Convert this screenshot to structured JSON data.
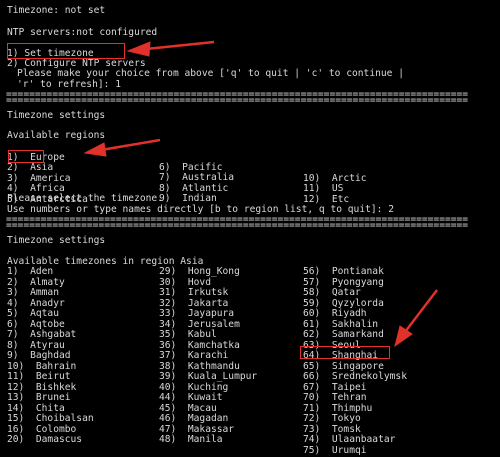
{
  "status": {
    "timezone": "Timezone: not set",
    "ntp": "NTP servers:not configured"
  },
  "main_menu": {
    "items": [
      {
        "num": "1)",
        "label": "Set timezone"
      },
      {
        "num": "2)",
        "label": "Configure NTP servers"
      }
    ],
    "prompt_line1": "Please make your choice from above ['q' to quit | 'c' to continue |",
    "prompt_line2": "'r' to refresh]: 1"
  },
  "separator": "================================================================================",
  "regions_section": {
    "title": "Timezone settings",
    "heading": "Available regions",
    "col1": [
      "1)  Europe",
      "2)  Asia",
      "3)  America",
      "4)  Africa",
      "5)  Antarctica"
    ],
    "col2": [
      "6)  Pacific",
      "7)  Australia",
      "8)  Atlantic",
      "9)  Indian"
    ],
    "col3": [
      "10)  Arctic",
      "11)  US",
      "12)  Etc"
    ],
    "prompt1": "Please select the timezone.",
    "prompt2": "Use numbers or type names directly [b to region list, q to quit]: 2"
  },
  "timezones_section": {
    "title": "Timezone settings",
    "heading": "Available timezones in region Asia",
    "col1": [
      "1)  Aden",
      "2)  Almaty",
      "3)  Amman",
      "4)  Anadyr",
      "5)  Aqtau",
      "6)  Aqtobe",
      "7)  Ashgabat",
      "8)  Atyrau",
      "9)  Baghdad",
      "10)  Bahrain",
      "11)  Beirut",
      "12)  Bishkek",
      "13)  Brunei",
      "14)  Chita",
      "15)  Choibalsan",
      "16)  Colombo",
      "20)  Damascus"
    ],
    "col2": [
      "29)  Hong_Kong",
      "30)  Hovd",
      "31)  Irkutsk",
      "32)  Jakarta",
      "33)  Jayapura",
      "34)  Jerusalem",
      "35)  Kabul",
      "36)  Kamchatka",
      "37)  Karachi",
      "38)  Kathmandu",
      "39)  Kuala_Lumpur",
      "40)  Kuching",
      "44)  Kuwait",
      "45)  Macau",
      "46)  Magadan",
      "47)  Makassar",
      "48)  Manila"
    ],
    "col3": [
      "56)  Pontianak",
      "57)  Pyongyang",
      "58)  Qatar",
      "59)  Qyzylorda",
      "60)  Riyadh",
      "61)  Sakhalin",
      "62)  Samarkand",
      "63)  Seoul",
      "64)  Shanghai",
      "65)  Singapore",
      "66)  Srednekolymsk",
      "67)  Taipei",
      "70)  Tehran",
      "71)  Thimphu",
      "72)  Tokyo",
      "73)  Tomsk",
      "74)  Ulaanbaatar",
      "75)  Urumqi"
    ]
  },
  "colors": {
    "background": "#000000",
    "text": "#d9d9d9",
    "annotation": "#e0312a"
  }
}
